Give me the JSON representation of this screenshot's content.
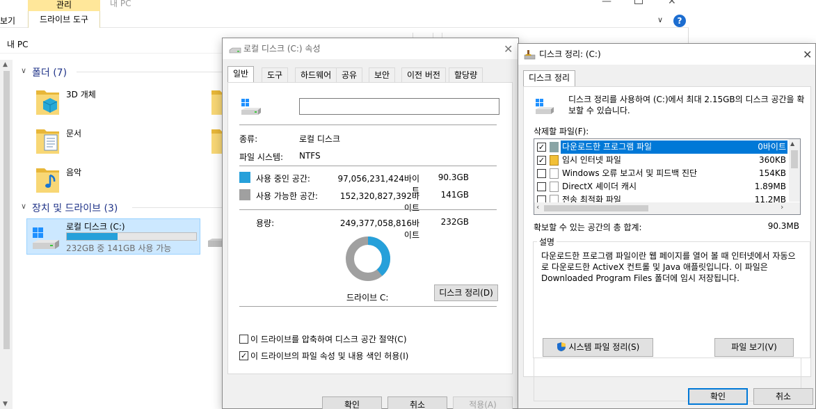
{
  "explorer": {
    "ribbon_manage": "관리",
    "ribbon_title": "내 PC",
    "ribbon_view": "보기",
    "ribbon_drive_tools": "드라이브 도구",
    "address": "내 PC",
    "folders_header": "폴더 (7)",
    "folders": [
      "3D 개체",
      "문서",
      "음악"
    ],
    "devices_header": "장치 및 드라이브 (3)",
    "drive": {
      "name": "로컬 디스크 (C:)",
      "free_text": "232GB 중 141GB 사용 가능",
      "used_fraction": 0.39
    }
  },
  "properties": {
    "title": "로컬 디스크 (C:) 속성",
    "tabs": [
      "일반",
      "도구",
      "하드웨어",
      "공유",
      "보안",
      "이전 버전",
      "할당량"
    ],
    "name_value": "",
    "type_label": "종류:",
    "type_value": "로컬 디스크",
    "fs_label": "파일 시스템:",
    "fs_value": "NTFS",
    "used_label": "사용 중인 공간:",
    "used_bytes": "97,056,231,424바이트",
    "used_gb": "90.3GB",
    "free_label": "사용 가능한 공간:",
    "free_bytes": "152,320,827,392바이트",
    "free_gb": "141GB",
    "capacity_label": "용량:",
    "capacity_bytes": "249,377,058,816바이트",
    "capacity_gb": "232GB",
    "used_ratio": 0.389,
    "drive_label": "드라이브 C:",
    "cleanup_button": "디스크 정리(D)",
    "compress_label": "이 드라이브를 압축하여 디스크 공간 절약(C)",
    "compress_checked": "",
    "index_label": "이 드라이브의 파일 속성 및 내용 색인 허용(I)",
    "index_checked": "✓",
    "ok": "확인",
    "cancel": "취소",
    "apply": "적용(A)",
    "colors": {
      "used": "#26a0da",
      "free": "#a0a0a0"
    }
  },
  "cleanup": {
    "title": "디스크 정리: (C:)",
    "tab": "디스크 정리",
    "intro": "디스크 정리를 사용하여 (C:)에서 최대 2.15GB의 디스크 공간을 확보할 수 있습니다.",
    "files_label": "삭제할 파일(F):",
    "files": [
      {
        "check": "✓",
        "name": "다운로드한 프로그램 파일",
        "size": "0바이트",
        "selected": true
      },
      {
        "check": "✓",
        "name": "임시 인터넷 파일",
        "size": "360KB",
        "selected": false
      },
      {
        "check": "",
        "name": "Windows 오류 보고서 및 피드백 진단",
        "size": "154KB",
        "selected": false
      },
      {
        "check": "",
        "name": "DirectX 셰이더 캐시",
        "size": "1.89MB",
        "selected": false
      },
      {
        "check": "",
        "name": "전송 최적화 파일",
        "size": "11.2MB",
        "selected": false
      }
    ],
    "total_label": "확보할 수 있는 공간의 총 합계:",
    "total_value": "90.3MB",
    "desc_title": "설명",
    "desc_text": "다운로드한 프로그램 파일이란 웹 페이지를 열어 볼 때 인터넷에서 자동으로 다운로드한 ActiveX 컨트롤 및 Java 애플릿입니다. 이 파일은 Downloaded Program Files 폴더에 임시 저장됩니다.",
    "system_cleanup": "시스템 파일 정리(S)",
    "view_files": "파일 보기(V)",
    "ok": "확인",
    "cancel": "취소"
  }
}
